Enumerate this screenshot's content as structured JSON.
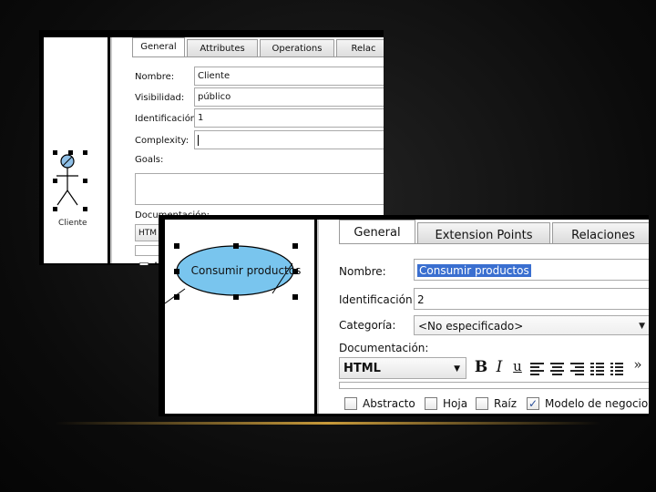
{
  "actor_editor": {
    "tabs": [
      "General",
      "Attributes",
      "Operations",
      "Relac"
    ],
    "active_tab": "General",
    "fields": {
      "name": {
        "label": "Nombre:",
        "value": "Cliente"
      },
      "visibility": {
        "label": "Visibilidad:",
        "value": "público"
      },
      "identification": {
        "label": "Identificación:",
        "value": "1"
      },
      "complexity": {
        "label": "Complexity:",
        "value": ""
      },
      "goals": {
        "label": "Goals:",
        "value": ""
      },
      "documentation": {
        "label": "Documentación:"
      }
    },
    "format_selector": "HTM",
    "checkbox_label": "A",
    "actor": {
      "name": "Cliente",
      "icon": "actor-stick-figure-icon"
    }
  },
  "usecase_editor": {
    "tabs": [
      "General",
      "Extension Points",
      "Relaciones"
    ],
    "active_tab": "General",
    "fields": {
      "name": {
        "label": "Nombre:",
        "value": "Consumir productos"
      },
      "identification": {
        "label": "Identificación:",
        "value": "2"
      },
      "category": {
        "label": "Categoría:",
        "value": "<No especificado>"
      },
      "documentation": {
        "label": "Documentación:"
      }
    },
    "format_selector": "HTML",
    "toolbar": {
      "bold": "B",
      "italic": "I",
      "underline": "u",
      "more": "»",
      "icons": [
        "bold-icon",
        "italic-icon",
        "underline-icon",
        "align-left-icon",
        "align-center-icon",
        "align-right-icon",
        "numbered-list-icon",
        "bullet-list-icon",
        "more-icon"
      ]
    },
    "checkboxes": [
      {
        "label": "Abstracto",
        "checked": false
      },
      {
        "label": "Hoja",
        "checked": false
      },
      {
        "label": "Raíz",
        "checked": false
      },
      {
        "label": "Modelo de negocio",
        "checked": true
      }
    ],
    "usecase": {
      "name": "Consumir productos",
      "fill_color": "#79c5ee"
    }
  },
  "colors": {
    "background": "#0b0b0b",
    "accent_line": "#c89a3a",
    "selection": "#3a6fd0",
    "usecase_fill": "#79c5ee"
  }
}
